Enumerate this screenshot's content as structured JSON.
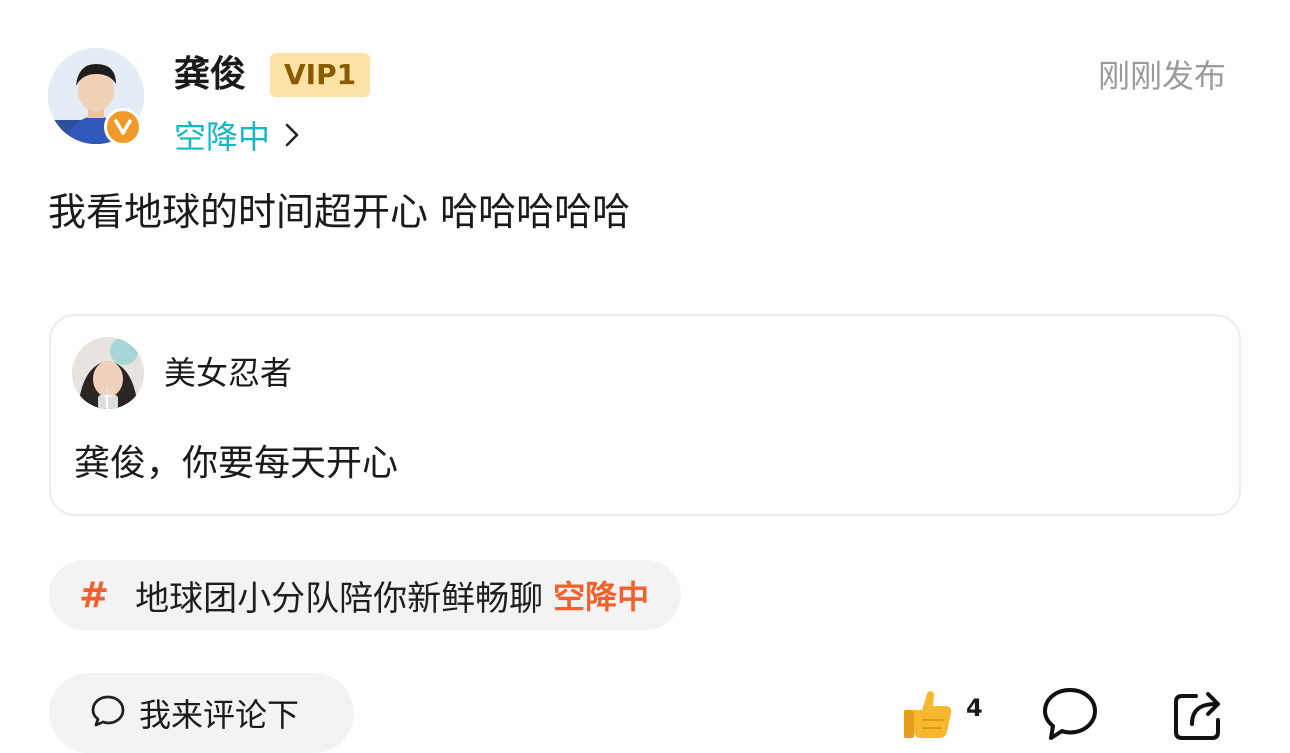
{
  "header": {
    "username": "龚俊",
    "vip_label": "VIP1",
    "status_text": "空降中",
    "timestamp": "刚刚发布",
    "verified_badge": "V"
  },
  "post": {
    "text": "我看地球的时间超开心 哈哈哈哈哈"
  },
  "quote": {
    "author": "美女忍者",
    "text": "龚俊，你要每天开心"
  },
  "topic": {
    "hash": "#",
    "title": "地球团小分队陪你新鲜畅聊",
    "status": "空降中"
  },
  "footer": {
    "comment_placeholder": "我来评论下",
    "like_count": "4"
  },
  "colors": {
    "accent_teal": "#16b7c4",
    "accent_orange": "#f0612d",
    "vip_bg": "#fbe3a7",
    "verified": "#f19a2a"
  },
  "icons": [
    "verified-icon",
    "chevron-right-icon",
    "chat-bubble-icon",
    "thumbs-up-icon",
    "comment-icon",
    "share-icon"
  ]
}
